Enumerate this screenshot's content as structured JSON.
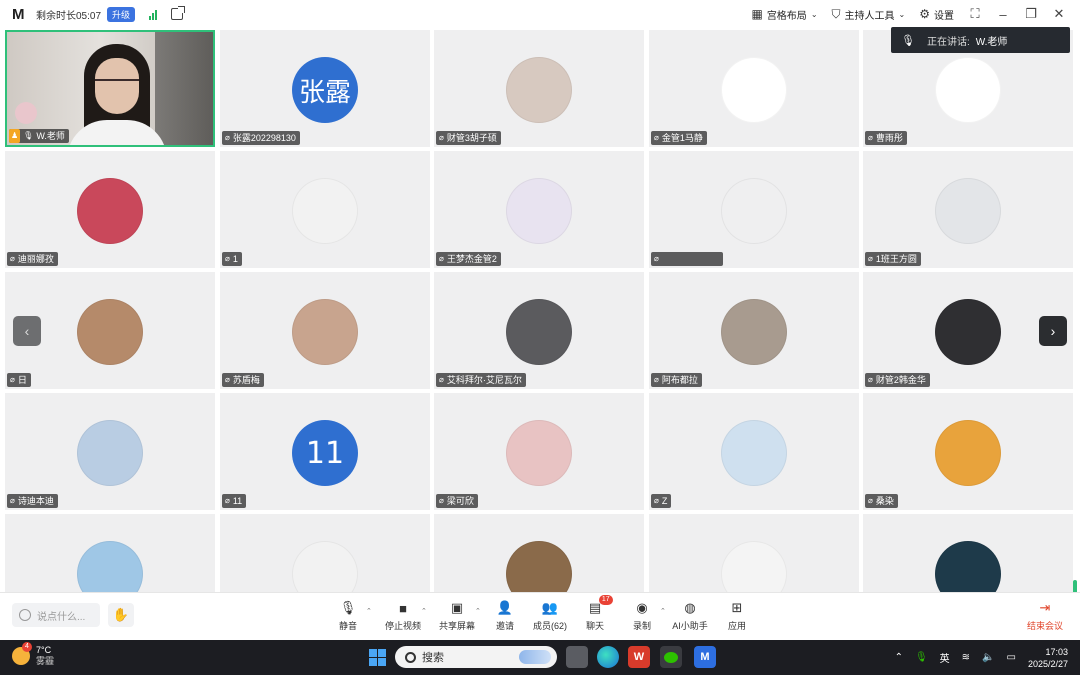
{
  "titlebar": {
    "remaining_time": "剩余时长05:07",
    "upgrade": "升级",
    "layout": "宫格布局",
    "host_tools": "主持人工具",
    "settings": "设置"
  },
  "speaking": {
    "label": "正在讲话:",
    "speaker": "W.老师"
  },
  "participants": [
    {
      "name": "W.老师",
      "type": "camera",
      "host": true
    },
    {
      "name": "张露202298130",
      "type": "text",
      "avatar_text": "张露",
      "color": "#2f6fd0"
    },
    {
      "name": "财管3胡子硕",
      "type": "pic",
      "color": "#d7c9c0",
      "icon": "cat-photo-icon"
    },
    {
      "name": "金管1马静",
      "type": "pic",
      "color": "#ffffff",
      "icon": "cartoon-fruit-icon"
    },
    {
      "name": "曹雨彤",
      "type": "pic",
      "color": "#ffffff",
      "icon": "mangosteen-icon"
    },
    {
      "name": "迪丽娜孜",
      "type": "pic",
      "color": "#c9485b",
      "icon": "person-photo-icon"
    },
    {
      "name": "1",
      "type": "pic",
      "color": "#f2f2f2",
      "icon": "anime-boy-icon"
    },
    {
      "name": "王梦杰金管2",
      "type": "pic",
      "color": "#e8e3f0",
      "icon": "anime-girl-icon"
    },
    {
      "name": "",
      "type": "pic",
      "color": "#efeff0",
      "icon": "gold-treasure-icon"
    },
    {
      "name": "1班王方圆",
      "type": "pic",
      "color": "#e3e5e8",
      "icon": "anime-character-icon"
    },
    {
      "name": "日",
      "type": "pic",
      "color": "#b58a6a",
      "icon": "cat-photo-icon"
    },
    {
      "name": "苏盾梅",
      "type": "pic",
      "color": "#c8a48e",
      "icon": "person-photo-icon"
    },
    {
      "name": "艾科拜尔·艾尼瓦尔",
      "type": "pic",
      "color": "#5b5b5e",
      "icon": "person-photo-icon"
    },
    {
      "name": "阿布都拉",
      "type": "pic",
      "color": "#a89b8f",
      "icon": "person-photo-icon"
    },
    {
      "name": "财管2韩金华",
      "type": "pic",
      "color": "#2f2f32",
      "icon": "person-photo-icon"
    },
    {
      "name": "诗迪本迪",
      "type": "pic",
      "color": "#b9cde3",
      "icon": "person-photo-icon"
    },
    {
      "name": "11",
      "type": "text",
      "avatar_text": "11",
      "color": "#2f6fd0"
    },
    {
      "name": "梁可欣",
      "type": "pic",
      "color": "#e8c3c3",
      "icon": "person-photo-icon"
    },
    {
      "name": "Z",
      "type": "pic",
      "color": "#cfe0ef",
      "icon": "cartoon-cat-icon"
    },
    {
      "name": "桑染",
      "type": "pic",
      "color": "#e8a33c",
      "icon": "cat-photo-icon"
    },
    {
      "name": "",
      "type": "pic",
      "color": "#9fc7e6",
      "icon": "cartoon-dragon-icon"
    },
    {
      "name": "",
      "type": "pic",
      "color": "#f2f2f2",
      "icon": "panda-icon"
    },
    {
      "name": "",
      "type": "pic",
      "color": "#8a6a4a",
      "icon": "dog-photo-icon"
    },
    {
      "name": "",
      "type": "pic",
      "color": "#f4f4f4",
      "icon": "panda-cartoon-icon"
    },
    {
      "name": "",
      "type": "pic",
      "color": "#1e3a4a",
      "icon": "night-sky-icon"
    }
  ],
  "chat": {
    "placeholder": "说点什么..."
  },
  "toolbar": [
    {
      "label": "静音",
      "icon": "microphone-icon",
      "caret": true
    },
    {
      "label": "停止视频",
      "icon": "video-camera-icon",
      "caret": true
    },
    {
      "label": "共享屏幕",
      "icon": "share-screen-icon",
      "caret": true
    },
    {
      "label": "邀请",
      "icon": "add-user-icon",
      "caret": false
    },
    {
      "label": "成员(62)",
      "icon": "members-icon",
      "caret": false
    },
    {
      "label": "聊天",
      "icon": "chat-icon",
      "caret": false,
      "badge": "17"
    },
    {
      "label": "录制",
      "icon": "record-icon",
      "caret": true
    },
    {
      "label": "AI小助手",
      "icon": "ai-assistant-icon",
      "caret": false
    },
    {
      "label": "应用",
      "icon": "apps-icon",
      "caret": false
    }
  ],
  "end_meeting": "结束会议",
  "taskbar": {
    "temperature": "7°C",
    "condition": "雾霾",
    "weather_badge": "4",
    "search_placeholder": "搜索",
    "ime": "英",
    "time": "17:03",
    "date": "2025/2/27"
  },
  "colors": {
    "accent": "#3b73e0",
    "speaking_border": "#2fc07a",
    "end_meeting": "#e0452b",
    "tile_bg": "#efeff0"
  }
}
